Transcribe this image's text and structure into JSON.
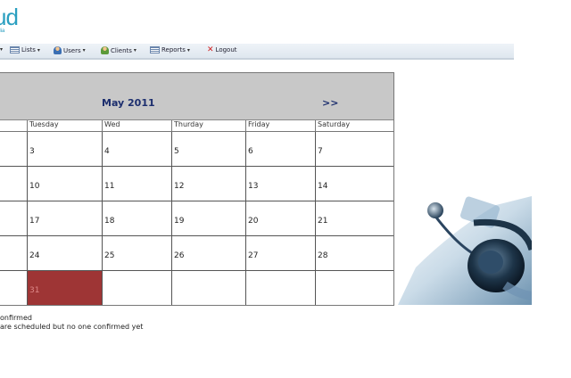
{
  "logo": {
    "main": "ud",
    "sub": "ralia"
  },
  "menu": {
    "items": [
      {
        "label": "Lists",
        "icon": "list-icon"
      },
      {
        "label": "Users",
        "icon": "users-icon"
      },
      {
        "label": "Clients",
        "icon": "clients-icon"
      },
      {
        "label": "Reports",
        "icon": "reports-icon"
      },
      {
        "label": "Logout",
        "icon": "logout-icon"
      }
    ]
  },
  "calendar": {
    "month_label": "May 2011",
    "next_label": ">>",
    "day_headers": [
      "",
      "Tuesday",
      "Wed",
      "Thurday",
      "Friday",
      "Saturday"
    ],
    "weeks": [
      [
        "",
        "3",
        "4",
        "5",
        "6",
        "7"
      ],
      [
        "",
        "10",
        "11",
        "12",
        "13",
        "14"
      ],
      [
        "",
        "17",
        "18",
        "19",
        "20",
        "21"
      ],
      [
        "",
        "24",
        "25",
        "26",
        "27",
        "28"
      ],
      [
        "",
        "31",
        "",
        "",
        "",
        ""
      ]
    ],
    "highlight_color": "#9e3535"
  },
  "legend": {
    "line1": "onfirmed",
    "line2": "are scheduled but no one confirmed yet"
  }
}
